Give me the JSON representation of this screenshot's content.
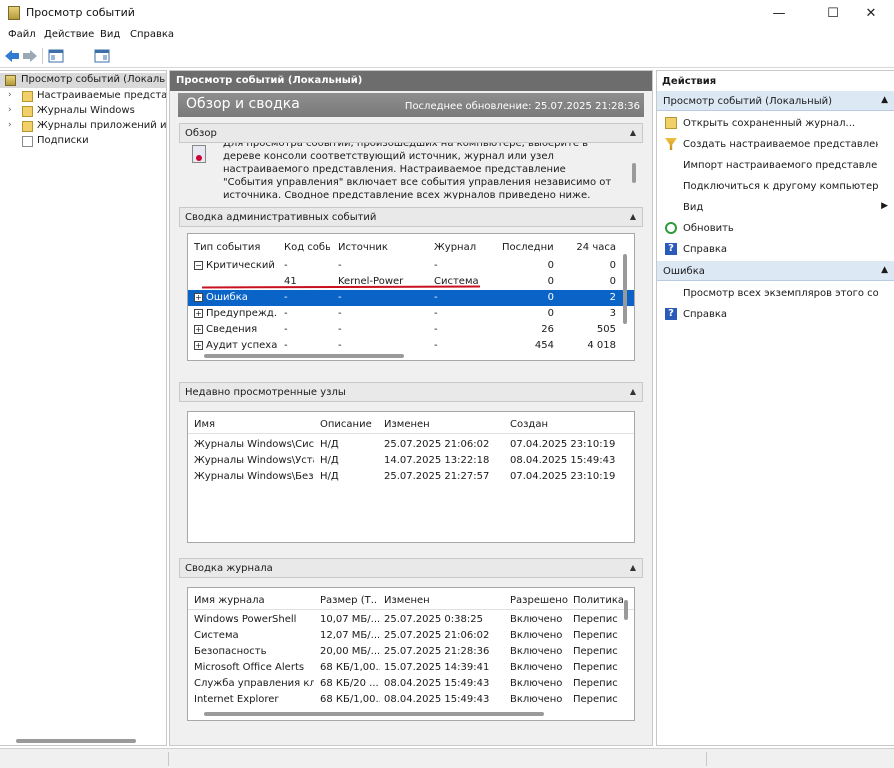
{
  "window": {
    "title": "Просмотр событий",
    "minimize": "—",
    "maximize": "☐",
    "close": "✕"
  },
  "menu": [
    "Файл",
    "Действие",
    "Вид",
    "Справка"
  ],
  "tree": [
    {
      "label": "Просмотр событий (Локальный)"
    },
    {
      "label": "Настраиваемые представления"
    },
    {
      "label": "Журналы Windows"
    },
    {
      "label": "Журналы приложений и служб"
    },
    {
      "label": "Подписки"
    }
  ],
  "center": {
    "header": "Просмотр событий (Локальный)",
    "overview_title": "Обзор и сводка",
    "last_update": "Последнее обновление: 25.07.2025 21:28:36",
    "overview": {
      "title": "Обзор",
      "text": "Для просмотра событий, произошедших на компьютере, выберите в дереве консоли соответствующий источник, журнал или узел настраиваемого представления. Настраиваемое представление \"События управления\" включает все события управления независимо от источника. Сводное представление всех журналов приведено ниже."
    },
    "admin": {
      "title": "Сводка административных событий",
      "columns": [
        "Тип события",
        "Код собы...",
        "Источник",
        "Журнал",
        "Последни...",
        "24 часа"
      ],
      "rows": [
        {
          "type": "Критический",
          "code": "-",
          "source": "-",
          "log": "-",
          "last": "0",
          "day": "0",
          "expander": "−"
        },
        {
          "type": "",
          "code": "41",
          "source": "Kernel-Power",
          "log": "Система",
          "last": "0",
          "day": "0",
          "expander": ""
        },
        {
          "type": "Ошибка",
          "code": "-",
          "source": "-",
          "log": "-",
          "last": "0",
          "day": "2",
          "expander": "+"
        },
        {
          "type": "Предупрежд...",
          "code": "-",
          "source": "-",
          "log": "-",
          "last": "0",
          "day": "3",
          "expander": "+"
        },
        {
          "type": "Сведения",
          "code": "-",
          "source": "-",
          "log": "-",
          "last": "26",
          "day": "505",
          "expander": "+"
        },
        {
          "type": "Аудит успеха",
          "code": "-",
          "source": "-",
          "log": "-",
          "last": "454",
          "day": "4 018",
          "expander": "+"
        }
      ]
    },
    "recent": {
      "title": "Недавно просмотренные узлы",
      "columns": [
        "Имя",
        "Описание",
        "Изменен",
        "Создан"
      ],
      "rows": [
        {
          "name": "Журналы Windows\\Сист...",
          "desc": "Н/Д",
          "modified": "25.07.2025 21:06:02",
          "created": "07.04.2025 23:10:19"
        },
        {
          "name": "Журналы Windows\\Уста...",
          "desc": "Н/Д",
          "modified": "14.07.2025 13:22:18",
          "created": "08.04.2025 15:49:43"
        },
        {
          "name": "Журналы Windows\\Безо...",
          "desc": "Н/Д",
          "modified": "25.07.2025 21:27:57",
          "created": "07.04.2025 23:10:19"
        }
      ]
    },
    "logs": {
      "title": "Сводка журнала",
      "columns": [
        "Имя журнала",
        "Размер (Т...",
        "Изменен",
        "Разрешено",
        "Политика"
      ],
      "rows": [
        {
          "name": "Windows PowerShell",
          "size": "10,07 МБ/...",
          "modified": "25.07.2025 0:38:25",
          "enabled": "Включено",
          "policy": "Переписы"
        },
        {
          "name": "Система",
          "size": "12,07 МБ/...",
          "modified": "25.07.2025 21:06:02",
          "enabled": "Включено",
          "policy": "Переписы"
        },
        {
          "name": "Безопасность",
          "size": "20,00 МБ/...",
          "modified": "25.07.2025 21:28:36",
          "enabled": "Включено",
          "policy": "Переписы"
        },
        {
          "name": "Microsoft Office Alerts",
          "size": "68 КБ/1,00...",
          "modified": "15.07.2025 14:39:41",
          "enabled": "Включено",
          "policy": "Переписы"
        },
        {
          "name": "Служба управления клю...",
          "size": "68 КБ/20 ...",
          "modified": "08.04.2025 15:49:43",
          "enabled": "Включено",
          "policy": "Переписы"
        },
        {
          "name": "Internet Explorer",
          "size": "68 КБ/1,00...",
          "modified": "08.04.2025 15:49:43",
          "enabled": "Включено",
          "policy": "Переписы"
        }
      ]
    }
  },
  "actions": {
    "title": "Действия",
    "group1": {
      "title": "Просмотр событий (Локальный)",
      "items": [
        "Открыть сохраненный журнал...",
        "Создать настраиваемое представление...",
        "Импорт настраиваемого представления",
        "Подключиться к другому компьютеру...",
        "Вид",
        "Обновить",
        "Справка"
      ]
    },
    "group2": {
      "title": "Ошибка",
      "items": [
        "Просмотр всех экземпляров этого событ...",
        "Справка"
      ]
    }
  },
  "colors": {
    "selection": "#0a64c8",
    "annotation": "#c8101e"
  }
}
